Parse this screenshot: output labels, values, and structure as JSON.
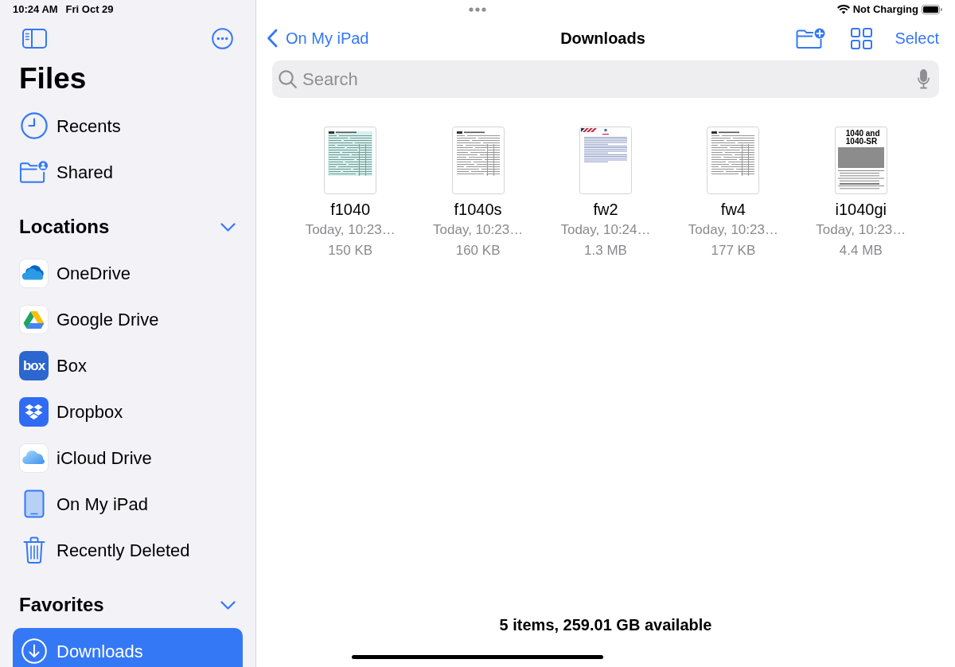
{
  "status_bar": {
    "time": "10:24 AM",
    "date": "Fri Oct 29",
    "battery_label": "Not Charging"
  },
  "sidebar": {
    "title": "Files",
    "items": [
      {
        "label": "Recents",
        "selected": false
      },
      {
        "label": "Shared",
        "selected": false
      }
    ],
    "sections": [
      {
        "title": "Locations",
        "expanded": true,
        "items": [
          {
            "label": "OneDrive",
            "selected": false
          },
          {
            "label": "Google Drive",
            "selected": false
          },
          {
            "label": "Box",
            "selected": false,
            "logo_text": "box"
          },
          {
            "label": "Dropbox",
            "selected": false
          },
          {
            "label": "iCloud Drive",
            "selected": false
          },
          {
            "label": "On My iPad",
            "selected": false
          },
          {
            "label": "Recently Deleted",
            "selected": false
          }
        ]
      },
      {
        "title": "Favorites",
        "expanded": true,
        "items": [
          {
            "label": "Downloads",
            "selected": true
          }
        ]
      }
    ]
  },
  "nav_bar": {
    "back_label": "On My iPad",
    "title": "Downloads",
    "select_label": "Select"
  },
  "search": {
    "placeholder": "Search"
  },
  "files": [
    {
      "kind": "tinted",
      "name": "f1040",
      "date": "Today, 10:23…",
      "size": "150 KB"
    },
    {
      "kind": "form",
      "name": "f1040s",
      "date": "Today, 10:23…",
      "size": "160 KB"
    },
    {
      "kind": "letter",
      "name": "fw2",
      "date": "Today, 10:24…",
      "size": "1.3 MB"
    },
    {
      "kind": "form",
      "name": "fw4",
      "date": "Today, 10:23…",
      "size": "177 KB"
    },
    {
      "kind": "cover",
      "name": "i1040gi",
      "date": "Today, 10:23…",
      "size": "4.4 MB",
      "cover_title": "1040 and 1040-SR"
    }
  ],
  "footer": "5 items, 259.01 GB available"
}
